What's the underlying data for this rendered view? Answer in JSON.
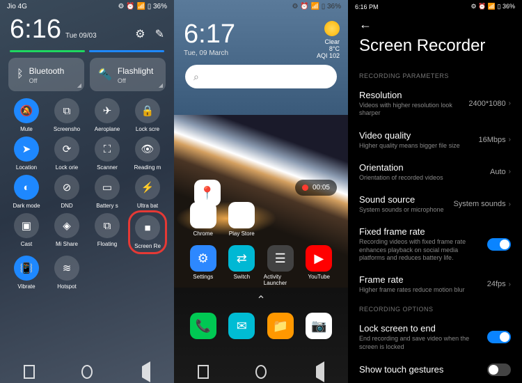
{
  "p1": {
    "carrier": "Jio 4G",
    "batt": "36%",
    "time": "6:16",
    "date": "Tue 09/03",
    "wide": [
      {
        "label": "Bluetooth",
        "sub": "Off",
        "glyph": "bt"
      },
      {
        "label": "Flashlight",
        "sub": "Off",
        "glyph": "flash"
      }
    ],
    "tiles": [
      {
        "label": "Mute",
        "active": true,
        "glyph": "mute"
      },
      {
        "label": "Screenshot",
        "active": false,
        "glyph": "shot"
      },
      {
        "label": "Aeroplane",
        "active": false,
        "glyph": "plane"
      },
      {
        "label": "Lock screen",
        "active": false,
        "glyph": "lock"
      },
      {
        "label": "Location",
        "active": true,
        "glyph": "loc"
      },
      {
        "label": "Lock orientation",
        "active": false,
        "glyph": "rot"
      },
      {
        "label": "Scanner",
        "active": false,
        "glyph": "scan"
      },
      {
        "label": "Reading mode",
        "active": false,
        "glyph": "eye"
      },
      {
        "label": "Dark mode",
        "active": true,
        "glyph": "dark"
      },
      {
        "label": "DND",
        "active": false,
        "glyph": "dnd"
      },
      {
        "label": "Battery saver",
        "active": false,
        "glyph": "batt"
      },
      {
        "label": "Ultra battery",
        "active": false,
        "glyph": "ultra"
      },
      {
        "label": "Cast",
        "active": false,
        "glyph": "cast"
      },
      {
        "label": "Mi Share",
        "active": false,
        "glyph": "share"
      },
      {
        "label": "Floating window",
        "active": false,
        "glyph": "float"
      },
      {
        "label": "Screen Recorder",
        "active": false,
        "glyph": "rec",
        "circled": true
      },
      {
        "label": "Vibrate",
        "active": true,
        "glyph": "vib"
      },
      {
        "label": "Hotspot",
        "active": false,
        "glyph": "hot"
      }
    ]
  },
  "p2": {
    "batt": "36%",
    "time": "6:17",
    "date": "Tue, 09 March",
    "weather": {
      "cond": "Clear",
      "temp": "8°C",
      "aqi": "AQI 102"
    },
    "rec": "00:05",
    "maps": {
      "label": "Maps"
    },
    "row1": [
      {
        "label": "Chrome",
        "bg": "#fff",
        "glyph": "◯"
      },
      {
        "label": "Play Store",
        "bg": "#fff",
        "glyph": "▶"
      },
      {
        "label": "",
        "bg": "",
        "glyph": ""
      },
      {
        "label": "",
        "bg": "",
        "glyph": ""
      }
    ],
    "row2": [
      {
        "label": "Settings",
        "bg": "#2d88ff",
        "glyph": "⚙"
      },
      {
        "label": "Switch",
        "bg": "#00b8d4",
        "glyph": "⇄"
      },
      {
        "label": "Activity Launcher",
        "bg": "#424242",
        "glyph": "☰"
      },
      {
        "label": "YouTube",
        "bg": "#ff0000",
        "glyph": "▶"
      }
    ],
    "dock": [
      {
        "bg": "#00c853",
        "glyph": "📞"
      },
      {
        "bg": "#00bcd4",
        "glyph": "✉"
      },
      {
        "bg": "#ff9800",
        "glyph": "📁"
      },
      {
        "bg": "#fff",
        "glyph": "📷"
      }
    ]
  },
  "p3": {
    "time": "6:16 PM",
    "batt": "36%",
    "title": "Screen Recorder",
    "sect1": "RECORDING PARAMETERS",
    "rows1": [
      {
        "t": "Resolution",
        "d": "Videos with higher resolution look sharper",
        "v": "2400*1080"
      },
      {
        "t": "Video quality",
        "d": "Higher quality means bigger file size",
        "v": "16Mbps"
      },
      {
        "t": "Orientation",
        "d": "Orientation of recorded videos",
        "v": "Auto"
      },
      {
        "t": "Sound source",
        "d": "System sounds or microphone",
        "v": "System sounds"
      }
    ],
    "toggles1": [
      {
        "t": "Fixed frame rate",
        "d": "Recording videos with fixed frame rate enhances playback on social media platforms and reduces battery life.",
        "on": true
      }
    ],
    "rows2": [
      {
        "t": "Frame rate",
        "d": "Higher frame rates reduce motion blur",
        "v": "24fps"
      }
    ],
    "sect2": "RECORDING OPTIONS",
    "toggles2": [
      {
        "t": "Lock screen to end",
        "d": "End recording and save video when the screen is locked",
        "on": true
      },
      {
        "t": "Show touch gestures",
        "d": "",
        "on": false
      }
    ]
  },
  "glyphs": {
    "mute": "🔕",
    "shot": "⧉",
    "plane": "✈",
    "lock": "🔒",
    "loc": "➤",
    "rot": "⟳",
    "scan": "⛶",
    "eye": "👁",
    "dark": "◐",
    "dnd": "⊘",
    "batt": "▭",
    "ultra": "⚡",
    "cast": "▣",
    "share": "◈",
    "float": "⧉",
    "rec": "■",
    "vib": "📳",
    "hot": "≋",
    "bt": "ᛒ",
    "flash": "🔦"
  }
}
